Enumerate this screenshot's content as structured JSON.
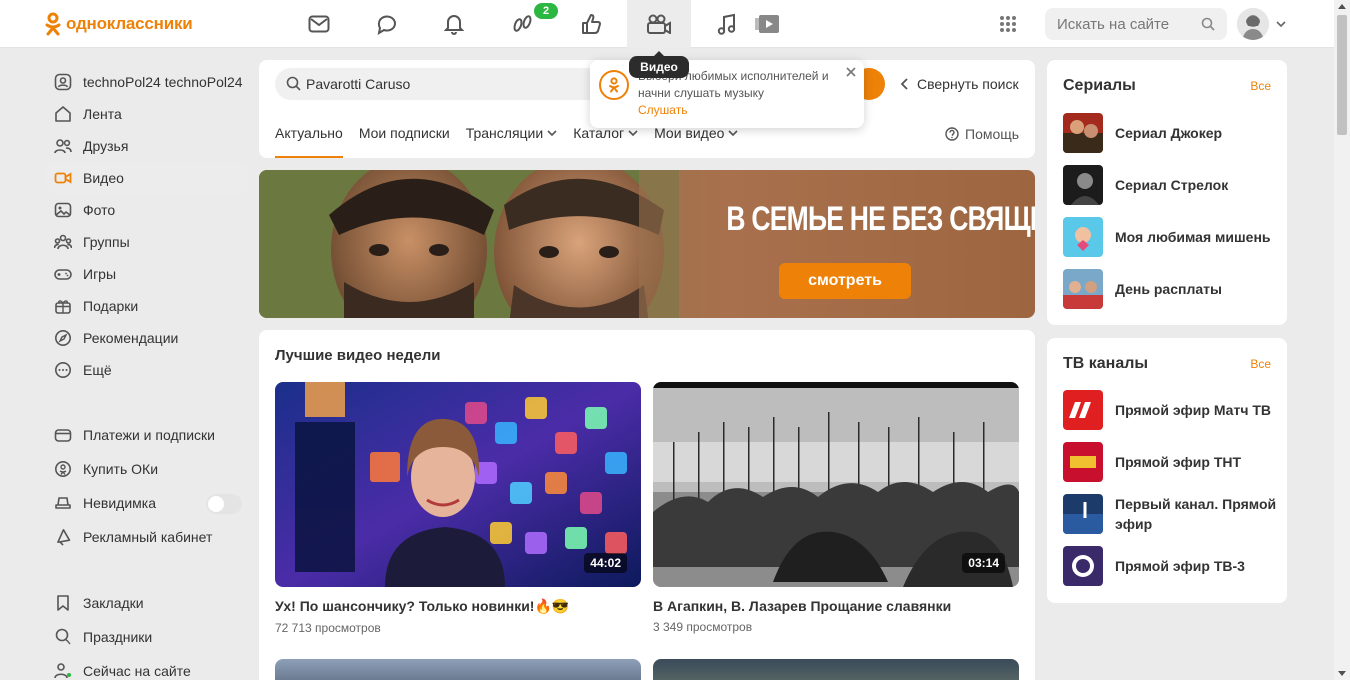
{
  "header": {
    "logo_text": "одноклассники",
    "nav": [
      {
        "name": "messages"
      },
      {
        "name": "discussions"
      },
      {
        "name": "notifications"
      },
      {
        "name": "guests",
        "badge": "2"
      },
      {
        "name": "marks"
      },
      {
        "name": "video",
        "active": true
      },
      {
        "name": "music"
      }
    ],
    "search_placeholder": "Искать на сайте"
  },
  "sidebar": {
    "items": [
      {
        "label": "technoPol24 technoPol24"
      },
      {
        "label": "Лента"
      },
      {
        "label": "Друзья"
      },
      {
        "label": "Видео",
        "active": true
      },
      {
        "label": "Фото"
      },
      {
        "label": "Группы"
      },
      {
        "label": "Игры"
      },
      {
        "label": "Подарки"
      },
      {
        "label": "Рекомендации"
      },
      {
        "label": "Ещё"
      }
    ],
    "items2": [
      {
        "label": "Платежи и подписки"
      },
      {
        "label": "Купить ОКи"
      },
      {
        "label": "Невидимка"
      },
      {
        "label": "Рекламный кабинет"
      }
    ],
    "items3": [
      {
        "label": "Закладки"
      },
      {
        "label": "Праздники"
      },
      {
        "label": "Сейчас на сайте"
      }
    ]
  },
  "video_search": {
    "query": "Pavarotti Caruso",
    "collapse_label": "Свернуть поиск",
    "tabs": [
      {
        "label": "Актуально",
        "active": true
      },
      {
        "label": "Мои подписки"
      },
      {
        "label": "Трансляции"
      },
      {
        "label": "Каталог"
      },
      {
        "label": "Мои видео"
      }
    ],
    "help_label": "Помощь"
  },
  "tooltip": {
    "label": "Видео"
  },
  "popup": {
    "text": "Выбери любимых исполнителей и начни слушать музыку",
    "link": "Слушать"
  },
  "banner": {
    "title": "В СЕМЬЕ НЕ БЕЗ СВЯЩЕННИКА",
    "button": "смотреть"
  },
  "best_videos": {
    "title": "Лучшие видео недели",
    "videos": [
      {
        "title": "Ух! По шансончику? Только новинки!🔥😎",
        "views": "72 713 просмотров",
        "duration": "44:02"
      },
      {
        "title": "В Агапкин, В. Лазарев Прощание славянки",
        "views": "3 349 просмотров",
        "duration": "03:14"
      }
    ]
  },
  "serials": {
    "title": "Сериалы",
    "all_label": "Все",
    "items": [
      {
        "label": "Сериал Джокер"
      },
      {
        "label": "Сериал Стрелок"
      },
      {
        "label": "Моя любимая мишень"
      },
      {
        "label": "День расплаты"
      }
    ]
  },
  "tv": {
    "title": "ТВ каналы",
    "all_label": "Все",
    "items": [
      {
        "label": "Прямой эфир Матч ТВ"
      },
      {
        "label": "Прямой эфир ТНТ"
      },
      {
        "label": "Первый канал. Прямой эфир"
      },
      {
        "label": "Прямой эфир ТВ-3"
      }
    ]
  },
  "colors": {
    "accent": "#ee8208",
    "badge": "#2cb742"
  }
}
